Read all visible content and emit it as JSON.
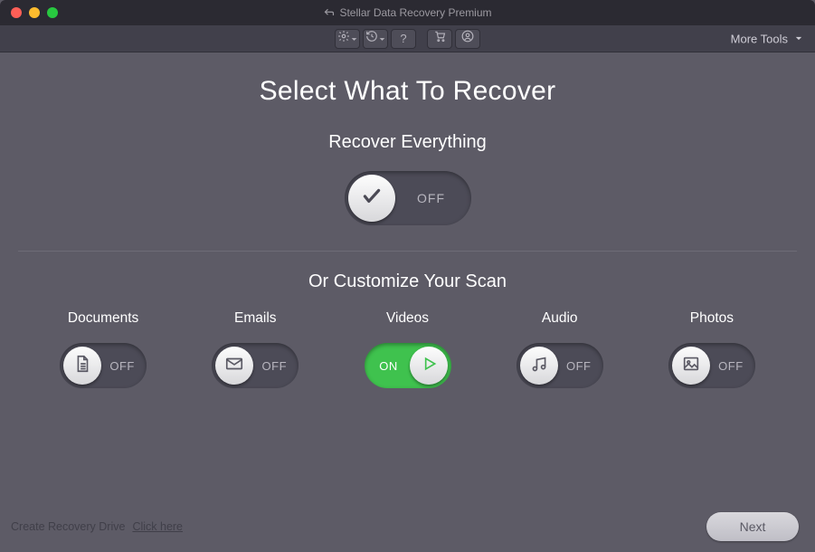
{
  "titlebar": {
    "title": "Stellar Data Recovery Premium"
  },
  "toolbar": {
    "more_tools": "More Tools"
  },
  "page": {
    "heading": "Select What To Recover",
    "recover_all_label": "Recover Everything",
    "recover_all_state": "OFF",
    "customize_label": "Or Customize Your Scan"
  },
  "categories": {
    "documents": {
      "label": "Documents",
      "state": "OFF"
    },
    "emails": {
      "label": "Emails",
      "state": "OFF"
    },
    "videos": {
      "label": "Videos",
      "state": "ON"
    },
    "audio": {
      "label": "Audio",
      "state": "OFF"
    },
    "photos": {
      "label": "Photos",
      "state": "OFF"
    }
  },
  "footer": {
    "recovery_drive": "Create Recovery Drive",
    "click_here": "Click here",
    "next": "Next"
  }
}
